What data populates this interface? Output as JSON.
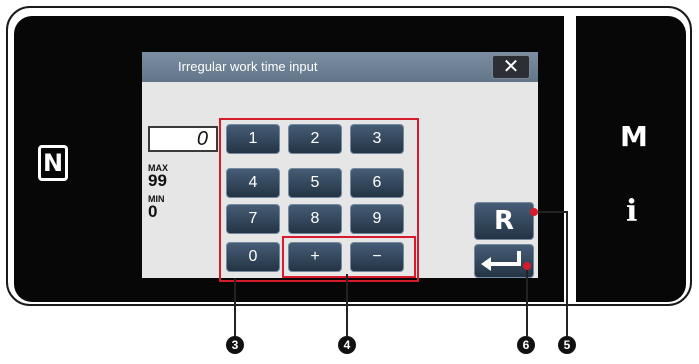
{
  "dialog": {
    "title": "Irregular work time input",
    "close_symbol": "✕",
    "current_value": "0",
    "max_label": "MAX",
    "max_value": "99",
    "min_label": "MIN",
    "min_value": "0"
  },
  "keypad": {
    "row1": [
      "1",
      "2",
      "3"
    ],
    "row2": [
      "4",
      "5",
      "6"
    ],
    "row3": [
      "7",
      "8",
      "9"
    ],
    "zero": "0",
    "plus": "+",
    "minus": "−"
  },
  "side": {
    "nfc_symbol": "N",
    "m_label": "M",
    "info_label": "i"
  },
  "reset_label": "R",
  "markers": {
    "keypad": "3",
    "plus_minus": "4",
    "reset": "5",
    "enter": "6"
  },
  "colors": {
    "highlight": "#d81b2c",
    "key": "#2f4257",
    "screen": "#070707"
  }
}
